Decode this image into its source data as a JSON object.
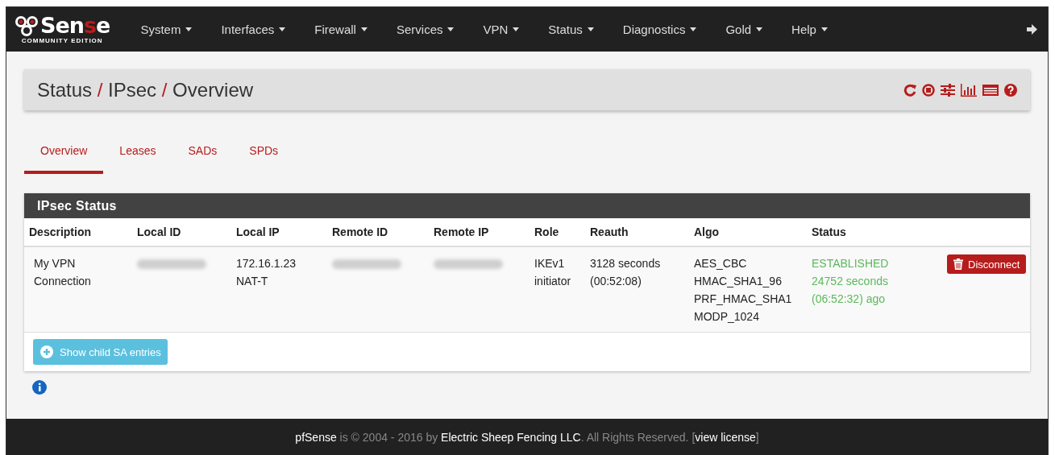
{
  "logo": {
    "word": "Sense",
    "subtitle": "COMMUNITY EDITION"
  },
  "nav": [
    {
      "label": "System"
    },
    {
      "label": "Interfaces"
    },
    {
      "label": "Firewall"
    },
    {
      "label": "Services"
    },
    {
      "label": "VPN"
    },
    {
      "label": "Status"
    },
    {
      "label": "Diagnostics"
    },
    {
      "label": "Gold"
    },
    {
      "label": "Help"
    }
  ],
  "breadcrumb": {
    "items": [
      "Status",
      "IPsec",
      "Overview"
    ],
    "separator": "/"
  },
  "tabs": [
    {
      "label": "Overview",
      "selected": true
    },
    {
      "label": "Leases",
      "selected": false
    },
    {
      "label": "SADs",
      "selected": false
    },
    {
      "label": "SPDs",
      "selected": false
    }
  ],
  "panel": {
    "title": "IPsec Status",
    "columns": [
      "Description",
      "Local ID",
      "Local IP",
      "Remote ID",
      "Remote IP",
      "Role",
      "Reauth",
      "Algo",
      "Status"
    ],
    "rows": [
      {
        "cells": [
          {
            "redacted": false,
            "lines": [
              "My VPN",
              "Connection"
            ]
          },
          {
            "redacted": true
          },
          {
            "redacted": false,
            "lines": [
              "172.16.1.23",
              "NAT-T"
            ]
          },
          {
            "redacted": true
          },
          {
            "redacted": true
          },
          {
            "redacted": false,
            "lines": [
              "IKEv1",
              "initiator"
            ]
          },
          {
            "redacted": false,
            "lines": [
              "3128 seconds",
              "(00:52:08)"
            ]
          },
          {
            "redacted": false,
            "lines": [
              "AES_CBC",
              "HMAC_SHA1_96",
              "PRF_HMAC_SHA1",
              "MODP_1024"
            ]
          },
          {
            "redacted": false,
            "kind": "status",
            "lines": [
              "ESTABLISHED",
              "24752 seconds",
              "(06:52:32) ago"
            ]
          }
        ],
        "action": "Disconnect"
      }
    ],
    "child_button": "Show child SA entries"
  },
  "footer": [
    {
      "text": "pfSense",
      "highlight": true
    },
    {
      "text": " is © 2004 - 2016 by ",
      "highlight": false
    },
    {
      "text": "Electric Sheep Fencing LLC",
      "highlight": true
    },
    {
      "text": ". All Rights Reserved. [",
      "highlight": false
    },
    {
      "text": "view license",
      "highlight": true,
      "link": true
    },
    {
      "text": "]",
      "highlight": false
    }
  ]
}
